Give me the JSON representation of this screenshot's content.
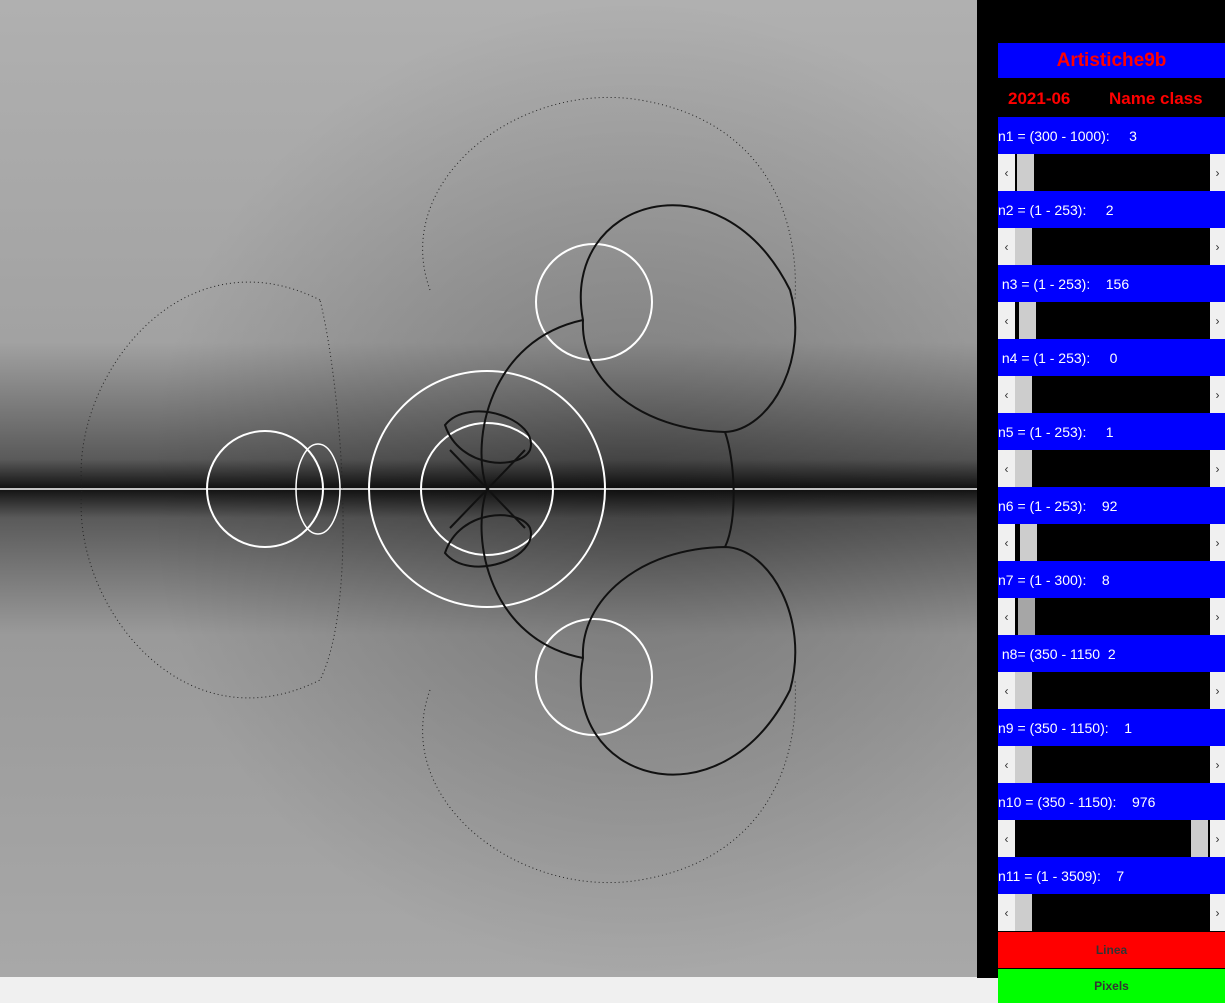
{
  "panel": {
    "title": "Artistiche9b",
    "date": "2021-06",
    "name_class": "Name class",
    "params": [
      {
        "label": "n1 = (300 - 1000):     3",
        "value": 3,
        "min": 300,
        "max": 1000
      },
      {
        "label": "n2 = (1 - 253):     2",
        "value": 2,
        "min": 1,
        "max": 253
      },
      {
        "label": " n3 = (1 - 253):    156",
        "value": 156,
        "min": 1,
        "max": 253
      },
      {
        "label": " n4 = (1 - 253):     0",
        "value": 0,
        "min": 1,
        "max": 253
      },
      {
        "label": "n5 = (1 - 253):     1",
        "value": 1,
        "min": 1,
        "max": 253
      },
      {
        "label": "n6 = (1 - 253):    92",
        "value": 92,
        "min": 1,
        "max": 253
      },
      {
        "label": "n7 = (1 - 300):    8",
        "value": 8,
        "min": 1,
        "max": 300
      },
      {
        "label": " n8= (350 - 1150  2",
        "value": 2,
        "min": 350,
        "max": 1150
      },
      {
        "label": "n9 = (350 - 1150):    1",
        "value": 1,
        "min": 350,
        "max": 1150
      },
      {
        "label": "n10 = (350 - 1150):    976",
        "value": 976,
        "min": 350,
        "max": 1150
      },
      {
        "label": "n11 = (1 - 3509):    7",
        "value": 7,
        "min": 1,
        "max": 3509
      }
    ],
    "slider_levels": [
      0.012,
      0.0,
      0.02,
      0.0,
      0.0,
      0.03,
      0.015,
      0.0,
      0.0,
      0.99,
      0.0
    ],
    "buttons": {
      "linea": "Linea",
      "pixels": "Pixels"
    },
    "colors": {
      "title_bg": "#0000ff",
      "title_text": "#ff0000",
      "linea": "#ff0000",
      "pixels": "#00ff00"
    }
  },
  "scroll_icons": {
    "left": "chevron-left-icon",
    "right": "chevron-right-icon"
  }
}
